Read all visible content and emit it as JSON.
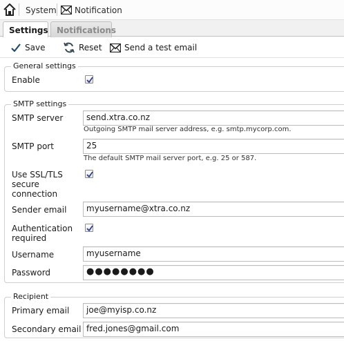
{
  "breadcrumb": {
    "home_icon": "home-icon",
    "system": "System",
    "notification_icon": "envelope-icon",
    "notification": "Notification"
  },
  "tabs": [
    {
      "label": "Settings",
      "active": true
    },
    {
      "label": "Notifications",
      "active": false
    }
  ],
  "toolbar": {
    "save": "Save",
    "reset": "Reset",
    "send_test": "Send a test email"
  },
  "general": {
    "legend": "General settings",
    "enable_label": "Enable",
    "enable_checked": true
  },
  "smtp": {
    "legend": "SMTP settings",
    "server_label": "SMTP server",
    "server_value": "send.xtra.co.nz",
    "server_hint": "Outgoing SMTP mail server address, e.g. smtp.mycorp.com.",
    "port_label": "SMTP port",
    "port_value": "25",
    "port_hint": "The default SMTP mail server port, e.g. 25 or 587.",
    "ssl_label_line1": "Use SSL/TLS",
    "ssl_label_line2": "secure",
    "ssl_label_line3": "connection",
    "ssl_checked": true,
    "sender_label": "Sender email",
    "sender_value": "myusername@xtra.co.nz",
    "auth_label_line1": "Authentication",
    "auth_label_line2": "required",
    "auth_checked": true,
    "username_label": "Username",
    "username_value": "myusername",
    "password_label": "Password",
    "password_value": "●●●●●●●●"
  },
  "recipient": {
    "legend": "Recipient",
    "primary_label": "Primary email",
    "primary_value": "joe@myisp.co.nz",
    "secondary_label": "Secondary email",
    "secondary_value": "fred.jones@gmail.com"
  },
  "colors": {
    "check_mark": "#2d3d8c",
    "reset_icon": "#3a4a55",
    "save_icon": "#1f4a6e"
  }
}
